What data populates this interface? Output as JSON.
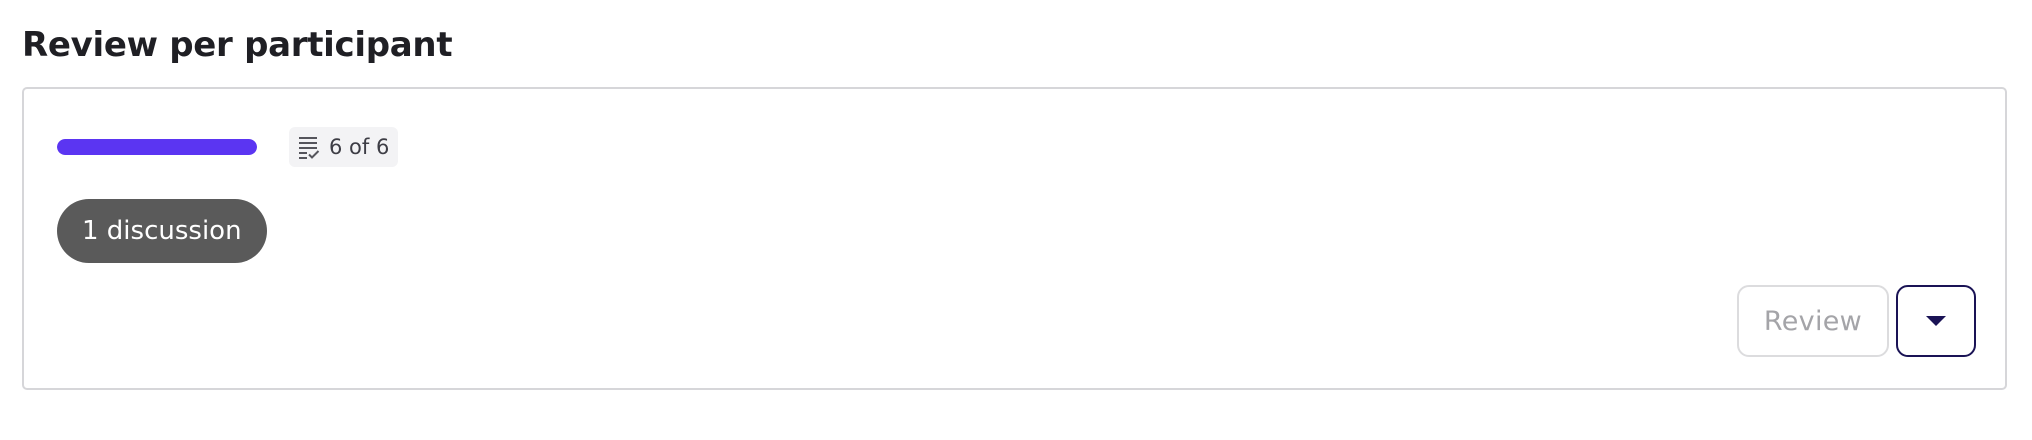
{
  "header": {
    "title": "Review per participant"
  },
  "participant_card": {
    "progress": {
      "fraction_complete": 1.0
    },
    "count_chip": {
      "icon": "checklist-icon",
      "text": "6 of 6"
    },
    "discussion_badge": {
      "text": "1 discussion"
    },
    "actions": {
      "review_label": "Review",
      "review_enabled": false,
      "dropdown_icon": "caret-down-icon"
    }
  },
  "colors": {
    "progress_fill": "#5b35f2",
    "discussion_badge_bg": "#5a5a5a",
    "dropdown_border": "#1a1355",
    "dropdown_caret": "#1a1355"
  }
}
